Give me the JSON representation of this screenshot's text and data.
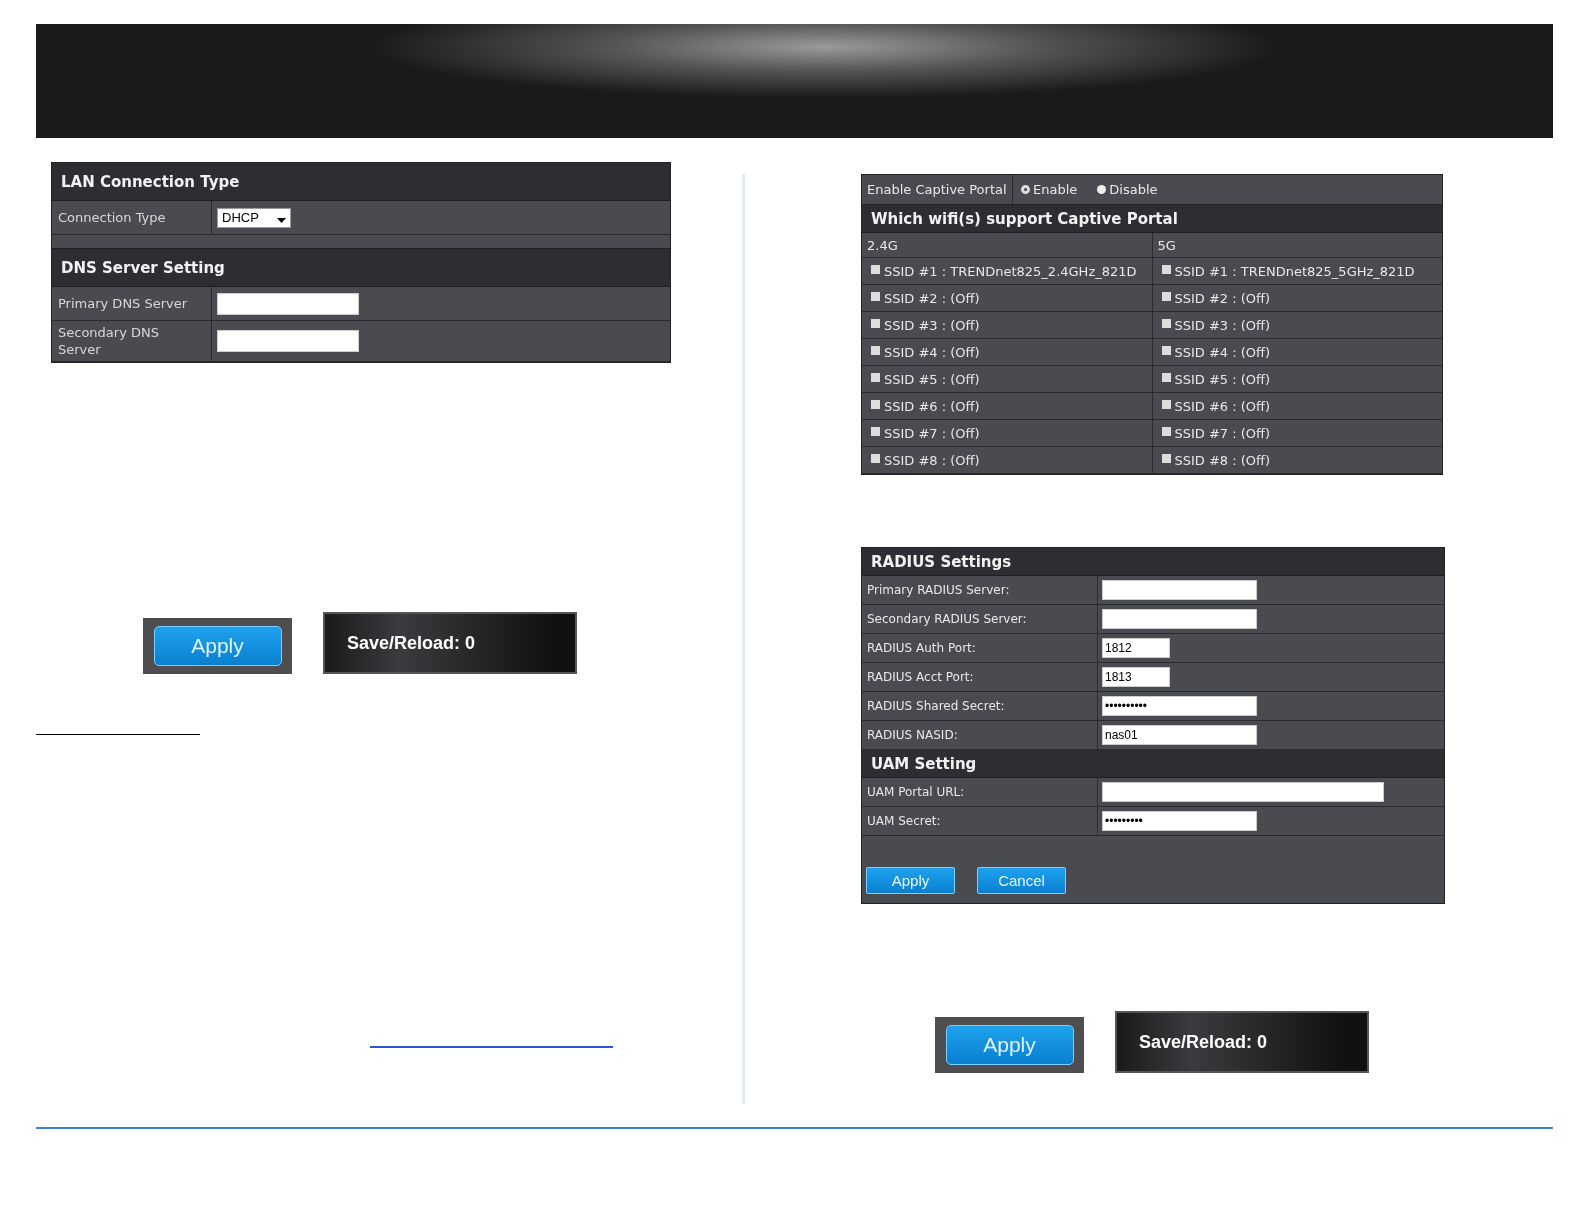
{
  "lan_panel": {
    "sections": [
      {
        "title": "LAN Connection Type",
        "fields": [
          {
            "label": "Connection Type",
            "kind": "select",
            "value": "DHCP"
          }
        ]
      },
      {
        "title": "DNS Server Setting",
        "fields": [
          {
            "label": "Primary DNS Server",
            "kind": "text"
          },
          {
            "label": "Secondary DNS Server",
            "kind": "text"
          }
        ]
      }
    ]
  },
  "left_actions": {
    "apply": "Apply",
    "save_reload": "Save/Reload: 0"
  },
  "captive_portal": {
    "label": "Enable Captive Portal",
    "options": [
      {
        "label": "Enable",
        "selected": true
      },
      {
        "label": "Disable",
        "selected": false
      }
    ],
    "title": "Which wifi(s) support Captive Portal",
    "bands": [
      {
        "name": "2.4G",
        "ssids": [
          {
            "label": "SSID #1 : TRENDnet825_2.4GHz_821D",
            "checked": false
          },
          {
            "label": "SSID #2 : (Off)",
            "checked": false
          },
          {
            "label": "SSID #3 : (Off)",
            "checked": false
          },
          {
            "label": "SSID #4 : (Off)",
            "checked": false
          },
          {
            "label": "SSID #5 : (Off)",
            "checked": false
          },
          {
            "label": "SSID #6 : (Off)",
            "checked": false
          },
          {
            "label": "SSID #7 : (Off)",
            "checked": false
          },
          {
            "label": "SSID #8 : (Off)",
            "checked": false
          }
        ]
      },
      {
        "name": "5G",
        "ssids": [
          {
            "label": "SSID #1 : TRENDnet825_5GHz_821D",
            "checked": false
          },
          {
            "label": "SSID #2 : (Off)",
            "checked": false
          },
          {
            "label": "SSID #3 : (Off)",
            "checked": false
          },
          {
            "label": "SSID #4 : (Off)",
            "checked": false
          },
          {
            "label": "SSID #5 : (Off)",
            "checked": false
          },
          {
            "label": "SSID #6 : (Off)",
            "checked": false
          },
          {
            "label": "SSID #7 : (Off)",
            "checked": false
          },
          {
            "label": "SSID #8 : (Off)",
            "checked": false
          }
        ]
      }
    ]
  },
  "radius_panel": {
    "sections": [
      {
        "title": "RADIUS Settings",
        "fields": [
          {
            "label": "Primary RADIUS Server:",
            "kind": "text"
          },
          {
            "label": "Secondary RADIUS Server:",
            "kind": "text"
          },
          {
            "label": "RADIUS Auth Port:",
            "kind": "port",
            "value": "1812"
          },
          {
            "label": "RADIUS Acct Port:",
            "kind": "port",
            "value": "1813"
          },
          {
            "label": "RADIUS Shared Secret:",
            "kind": "password",
            "value": "••••••••••"
          },
          {
            "label": "RADIUS NASID:",
            "kind": "text",
            "value": "nas01"
          }
        ]
      },
      {
        "title": "UAM Setting",
        "fields": [
          {
            "label": "UAM Portal URL:",
            "kind": "url"
          },
          {
            "label": "UAM Secret:",
            "kind": "password",
            "value": "•••••••••"
          }
        ]
      }
    ],
    "buttons": [
      "Apply",
      "Cancel"
    ]
  },
  "right_actions": {
    "apply": "Apply",
    "save_reload": "Save/Reload: 0"
  }
}
